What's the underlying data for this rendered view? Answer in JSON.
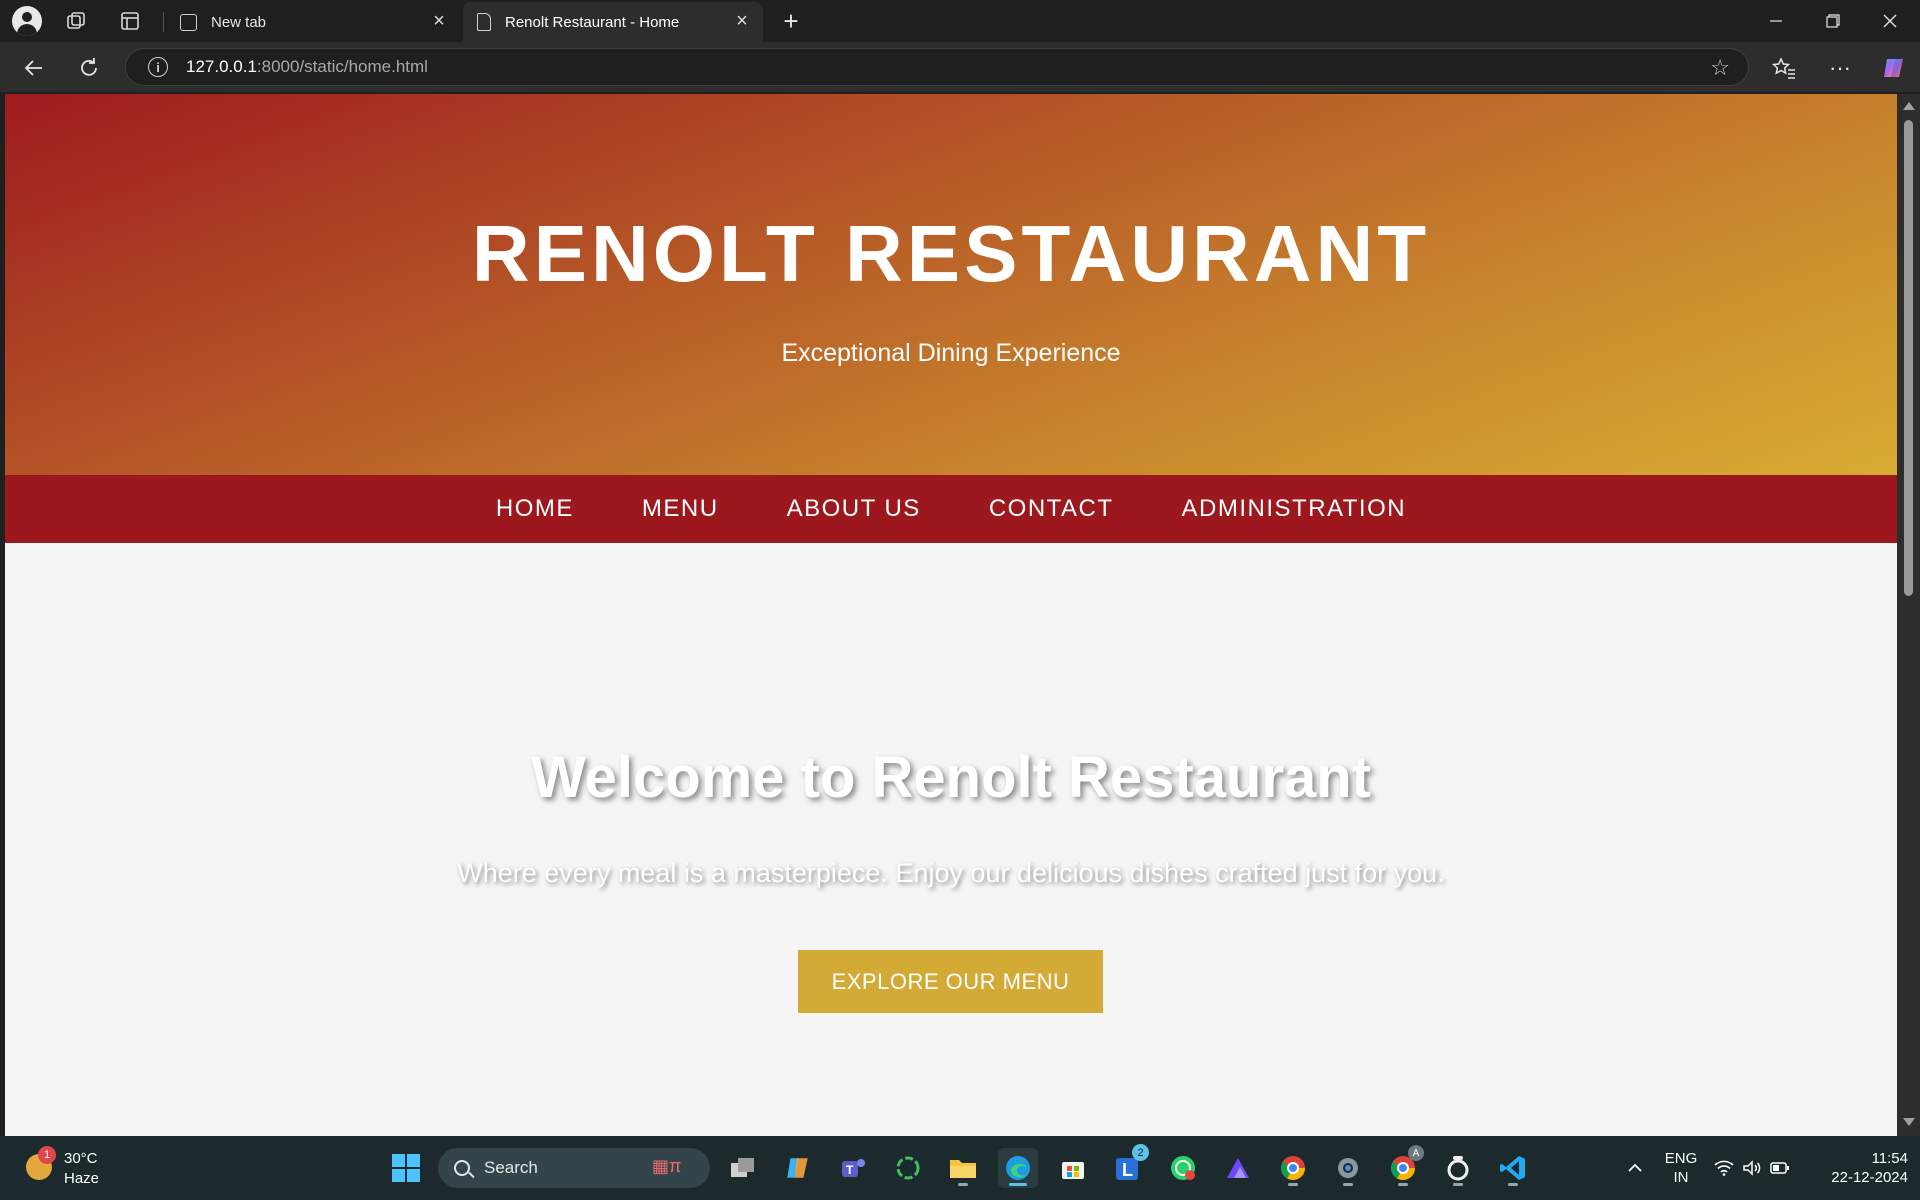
{
  "browser": {
    "tabs": [
      {
        "title": "New tab",
        "active": false
      },
      {
        "title": "Renolt Restaurant - Home",
        "active": true
      }
    ],
    "url_host": "127.0.0.1",
    "url_rest": ":8000/static/home.html"
  },
  "page": {
    "brand": "RENOLT RESTAURANT",
    "tagline": "Exceptional Dining Experience",
    "nav": [
      "HOME",
      "MENU",
      "ABOUT US",
      "CONTACT",
      "ADMINISTRATION"
    ],
    "welcome_title": "Welcome to Renolt Restaurant",
    "welcome_text": "Where every meal is a masterpiece. Enjoy our delicious dishes crafted just for you.",
    "cta_label": "EXPLORE OUR MENU",
    "colors": {
      "hero_gradient_start": "#9e1a1e",
      "hero_gradient_end": "#d8ad33",
      "nav_bar": "#9c181e",
      "cta": "#d3aa35",
      "page_bg": "#f5f5f5"
    }
  },
  "taskbar": {
    "weather_badge": "1",
    "temperature": "30°C",
    "condition": "Haze",
    "search_placeholder": "Search",
    "teams_badge": "2",
    "chrome_profile_badge": "A",
    "language": "ENG",
    "region": "IN",
    "time": "11:54",
    "date": "22-12-2024"
  }
}
